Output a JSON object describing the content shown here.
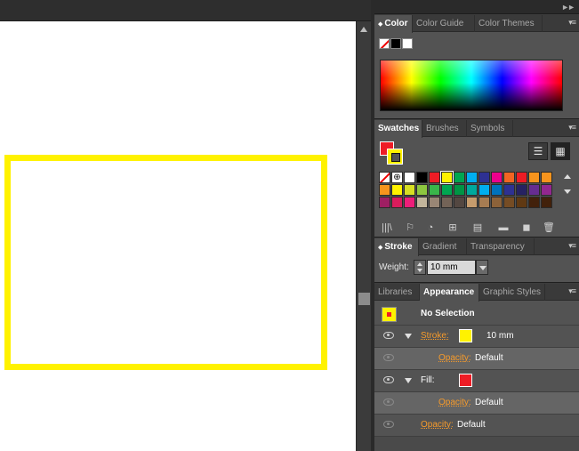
{
  "colors": {
    "fill": "#ee1c25",
    "stroke": "#fff200",
    "canvas": "#ffffff",
    "panel_bg": "#535353",
    "accent_link": "#f79b2b"
  },
  "color_panel": {
    "tabs": [
      {
        "label": "Color",
        "active": true
      },
      {
        "label": "Color Guide",
        "active": false
      },
      {
        "label": "Color Themes",
        "active": false
      }
    ]
  },
  "swatches_panel": {
    "tabs": [
      {
        "label": "Swatches",
        "active": true
      },
      {
        "label": "Brushes",
        "active": false
      },
      {
        "label": "Symbols",
        "active": false
      }
    ],
    "view_buttons": [
      "list-view-icon",
      "grid-view-icon"
    ],
    "rows": [
      [
        "none",
        "registration",
        "#ffffff",
        "#000000",
        "#ee1c25",
        "#fff200",
        "#00a650",
        "#00aeef",
        "#2e3192",
        "#ec008c",
        "#f26522",
        "#ed1c24",
        "#f7941d",
        "#f7941d"
      ],
      [
        "#f7941d",
        "#fff200",
        "#d7df23",
        "#8dc63f",
        "#39b54a",
        "#00a651",
        "#009444",
        "#00a99d",
        "#00aeef",
        "#0072bc",
        "#2e3192",
        "#262262",
        "#662d91",
        "#92278f"
      ],
      [
        "#9e1f63",
        "#d91c5c",
        "#ed1e79",
        "#c2b59b",
        "#998675",
        "#736357",
        "#534741",
        "#c69c6d",
        "#a67c52",
        "#8c6239",
        "#754c24",
        "#603913",
        "#42210b",
        "#42210b"
      ]
    ],
    "selected_index": [
      0,
      5
    ],
    "toolbar_icons": [
      "libraries-icon",
      "show-kinds-icon",
      "swatch-options-icon",
      "new-color-group-icon",
      "swatch-list-icon",
      "new-folder-icon",
      "new-swatch-icon",
      "delete-icon"
    ]
  },
  "stroke_panel": {
    "tabs": [
      {
        "label": "Stroke",
        "active": true
      },
      {
        "label": "Gradient",
        "active": false
      },
      {
        "label": "Transparency",
        "active": false
      }
    ],
    "weight_label": "Weight:",
    "weight_value": "10 mm"
  },
  "appearance_panel": {
    "tabs": [
      {
        "label": "Libraries",
        "active": false
      },
      {
        "label": "Appearance",
        "active": true
      },
      {
        "label": "Graphic Styles",
        "active": false
      }
    ],
    "header": "No Selection",
    "stroke_label": "Stroke:",
    "stroke_value": "10 mm",
    "opacity_label": "Opacity:",
    "opacity_value": "Default",
    "fill_label": "Fill:",
    "stroke_opacity": "Default",
    "fill_opacity": "Default",
    "object_opacity": "Default"
  }
}
